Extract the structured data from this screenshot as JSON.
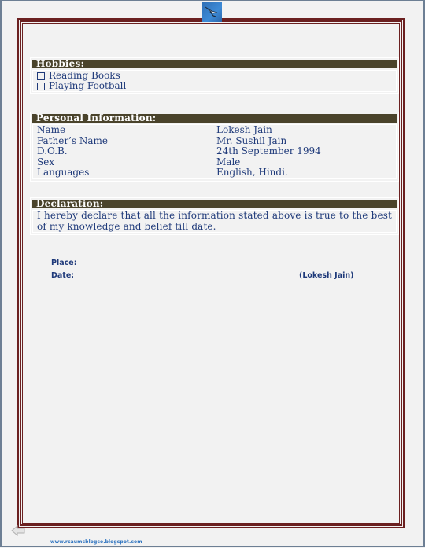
{
  "hobbies": {
    "title": "Hobbies:",
    "items": [
      "Reading Books",
      "Playing Football"
    ]
  },
  "personal": {
    "title": "Personal Information:",
    "rows": [
      {
        "label": "Name",
        "value": "Lokesh Jain"
      },
      {
        "label": "Father’s Name",
        "value": "Mr. Sushil Jain"
      },
      {
        "label": "D.O.B.",
        "value": "24th September 1994"
      },
      {
        "label": "Sex",
        "value": "Male"
      },
      {
        "label": "Languages",
        "value": "English, Hindi."
      }
    ]
  },
  "declaration": {
    "title": "Declaration:",
    "text": "I hereby declare that all the information stated above is true to the best of my knowledge and belief till date."
  },
  "signature": {
    "place_label": "Place:",
    "date_label": "Date:",
    "name": "(Lokesh Jain)"
  },
  "footer": {
    "link": "www.rcaumcblogco.blogspot.com"
  },
  "icons": {
    "top_badge": "bird-logo-icon",
    "back": "back-arrow-icon"
  },
  "colors": {
    "border": "#6b2020",
    "section_header": "#4a432b",
    "text": "#1f3a7a",
    "link": "#2f74c0"
  }
}
